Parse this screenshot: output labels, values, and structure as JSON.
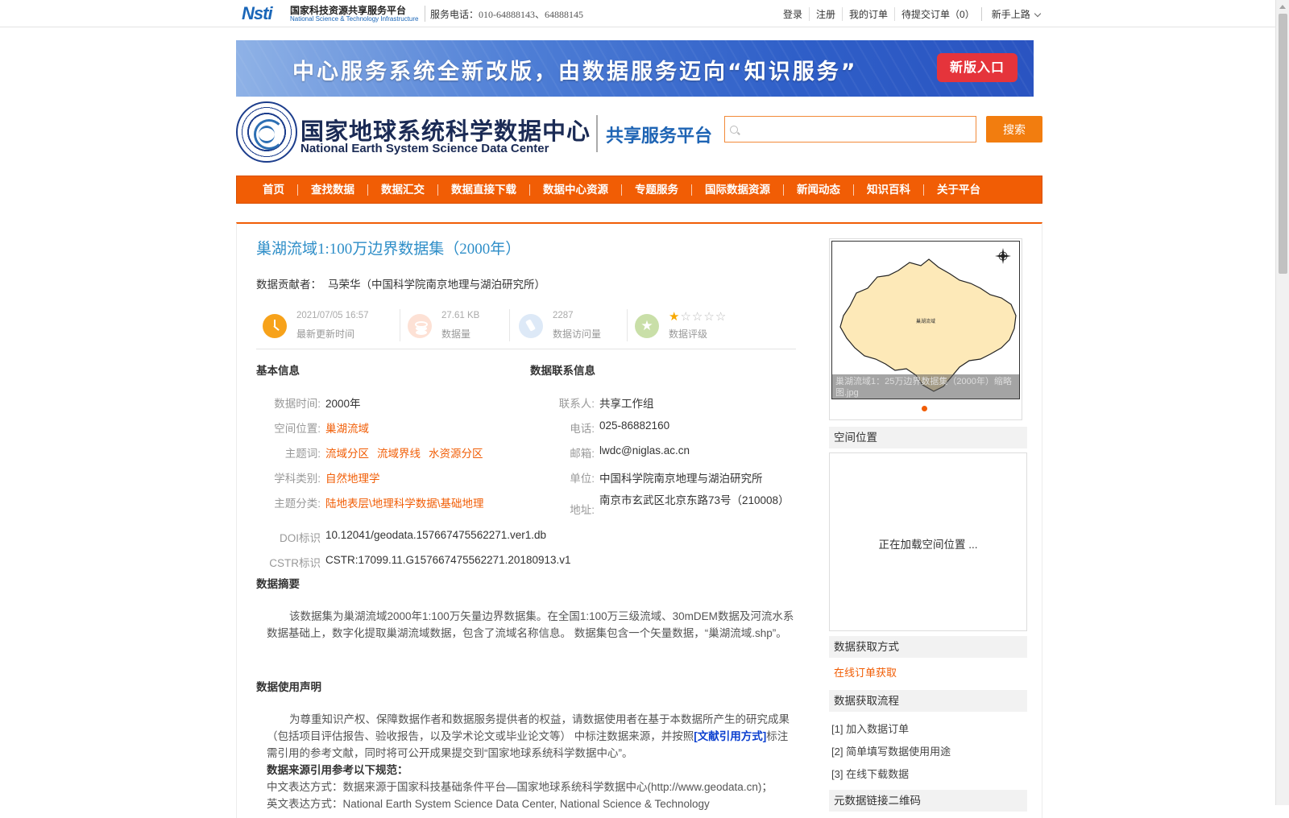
{
  "topbar": {
    "nsti_mark": "Nsti",
    "nsti_title": "国家科技资源共享服务平台",
    "nsti_sub": "National Science & Technology Infrastructure",
    "hotline_label": "服务电话：",
    "hotline_numbers": "010-64888143、64888145",
    "links": [
      "登录",
      "注册",
      "我的订单",
      "待提交订单（0）"
    ],
    "guide": "新手上路"
  },
  "banner": {
    "text": "中心服务系统全新改版，由数据服务迈向“知识服务”",
    "button": "新版入口"
  },
  "header": {
    "site_name": "国家地球系统科学数据中心",
    "site_en": "National Earth System Science Data Center",
    "platform": "共享服务平台",
    "search_placeholder": "",
    "search_button": "搜索"
  },
  "nav": [
    "首页",
    "查找数据",
    "数据汇交",
    "数据直接下载",
    "数据中心资源",
    "专题服务",
    "国际数据资源",
    "新闻动态",
    "知识百科",
    "关于平台"
  ],
  "dataset": {
    "title": "巢湖流域1:100万边界数据集（2000年）",
    "contributor_label": "数据贡献者：",
    "contributor": "马荣华（中国科学院南京地理与湖泊研究所）",
    "stats": {
      "updated_value": "2021/07/05 16:57",
      "updated_label": "最新更新时间",
      "size_value": "27.61 KB",
      "size_label": "数据量",
      "visits_value": "2287",
      "visits_label": "数据访问量",
      "rating_label": "数据评级",
      "rating": 1,
      "rating_max": 5
    }
  },
  "basic_info": {
    "heading": "基本信息",
    "time_label": "数据时间:",
    "time": "2000年",
    "location_label": "空间位置:",
    "location": "巢湖流域",
    "keywords_label": "主题词:",
    "keywords": [
      "流域分区",
      "流域界线",
      "水资源分区"
    ],
    "discipline_label": "学科类别:",
    "discipline": "自然地理学",
    "theme_label": "主题分类:",
    "theme": "陆地表层\\地理科学数据\\基础地理",
    "doi_label": "DOI标识",
    "doi": "10.12041/geodata.157667475562271.ver1.db",
    "cstr_label": "CSTR标识",
    "cstr": "CSTR:17099.11.G157667475562271.20180913.v1"
  },
  "contact_info": {
    "heading": "数据联系信息",
    "contact_label": "联系人:",
    "contact": "共享工作组",
    "phone_label": "电话:",
    "phone": "025-86882160",
    "email_label": "邮箱:",
    "email": "lwdc@niglas.ac.cn",
    "unit_label": "单位:",
    "unit": "中国科学院南京地理与湖泊研究所",
    "address_label": "地址:",
    "address": "南京市玄武区北京东路73号（210008）"
  },
  "abstract": {
    "heading": "数据摘要",
    "text": "该数据集为巢湖流域2000年1:100万矢量边界数据集。在全国1:100万三级流域、30mDEM数据及河流水系数据基础上，数字化提取巢湖流域数据，包含了流域名称信息。 数据集包含一个矢量数据，“巢湖流域.shp”。"
  },
  "usage": {
    "heading": "数据使用声明",
    "text_before": "为尊重知识产权、保障数据作者和数据服务提供者的权益，请数据使用者在基于本数据所产生的研究成果（包括项目评估报告、验收报告，以及学术论文或毕业论文等） 中标注数据来源，并按照",
    "link": "[文献引用方式]",
    "text_after": "标注需引用的参考文献，同时将可公开成果提交到“国家地球系统科学数据中心”。",
    "rule_heading": "数据来源引用参考以下规范：",
    "cn_format": "中文表达方式：数据来源于国家科技基础条件平台—国家地球系统科学数据中心(http://www.geodata.cn)；",
    "en_format": "英文表达方式：National Earth System Science Data Center, National Science & Technology"
  },
  "sidebar": {
    "map_label": "巢湖流域",
    "caption": "巢湖流域1：25万边界数据集（2000年）缩略图.jpg",
    "spatial_heading": "空间位置",
    "spatial_loading": "正在加载空间位置 ...",
    "access_heading": "数据获取方式",
    "access_link": "在线订单获取",
    "process_heading": "数据获取流程",
    "steps": [
      "[1] 加入数据订单",
      "[2] 简单填写数据使用用途",
      "[3] 在线下载数据"
    ],
    "qr_heading": "元数据链接二维码"
  },
  "colors": {
    "accent": "#f15d05",
    "title_blue": "#2e8ec8",
    "link_blue": "#0b3fcf"
  }
}
